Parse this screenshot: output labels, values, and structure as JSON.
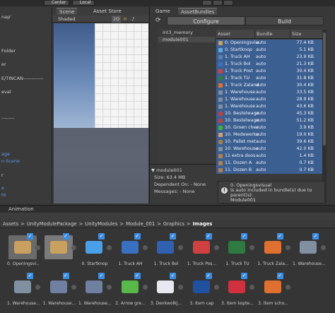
{
  "toolbar": {
    "center_label": "Center",
    "local_label": "Local"
  },
  "tabs": {
    "scene": "Scene",
    "asset_store": "Asset Store",
    "game": "Game",
    "asset_bundles": "AssetBundles"
  },
  "hierarchy": {
    "rows": [
      {
        "text": "nap'",
        "style": "normal"
      },
      {
        "text": "Folder",
        "style": "normal"
      },
      {
        "text": "er",
        "style": "normal"
      },
      {
        "text": "E/TINCAN------------",
        "style": "normal"
      },
      {
        "text": "eval",
        "style": "normal"
      },
      {
        "text": "--------",
        "style": "normal"
      },
      {
        "text": "age",
        "style": "blue"
      },
      {
        "text": "n Scene",
        "style": "blue"
      },
      {
        "text": "r",
        "style": "normal"
      },
      {
        "text": "e",
        "style": "blue"
      },
      {
        "text": "ht",
        "style": "blue"
      }
    ]
  },
  "scene_toolbar": {
    "shading_mode": "Shaded",
    "mode_2d": "2D"
  },
  "asset_bundles": {
    "configure_label": "Configure",
    "build_label": "Build",
    "refresh_icon": "refresh-icon",
    "bundles": [
      "int3_memory",
      "module001"
    ],
    "columns": [
      "Asset",
      "Bundle",
      "Size"
    ],
    "rows": [
      {
        "asset": "0. Openingsvisual",
        "bundle": "auto",
        "size": "77.4 KB",
        "color": "#c8a060"
      },
      {
        "asset": "0. Startknop",
        "bundle": "auto",
        "size": "5.1 KB",
        "color": "#60a8e0"
      },
      {
        "asset": "1. Truck AH",
        "bundle": "auto",
        "size": "23.9 KB",
        "color": "#5a80b0"
      },
      {
        "asset": "1. Truck Bol",
        "bundle": "auto",
        "size": "21.3 KB",
        "color": "#4070c0"
      },
      {
        "asset": "1. Truck Post",
        "bundle": "auto",
        "size": "30.4 KB",
        "color": "#d04040"
      },
      {
        "asset": "1. Truck TU",
        "bundle": "auto",
        "size": "31.8 KB",
        "color": "#308040"
      },
      {
        "asset": "1. Truck Zalando",
        "bundle": "auto",
        "size": "30.4 KB",
        "color": "#e07030"
      },
      {
        "asset": "1. Warehouse",
        "bundle": "auto",
        "size": "33.5 KB",
        "color": "#8090a0"
      },
      {
        "asset": "1. Warehouse",
        "bundle": "auto",
        "size": "28.9 KB",
        "color": "#8090a0"
      },
      {
        "asset": "1. Warehouse",
        "bundle": "auto",
        "size": "43.6 KB",
        "color": "#8090a0"
      },
      {
        "asset": "10. Bestelwagen",
        "bundle": "auto",
        "size": "45.3 KB",
        "color": "#c04040"
      },
      {
        "asset": "10. Bestelwagen",
        "bundle": "auto",
        "size": "51.2 KB",
        "color": "#c04040"
      },
      {
        "asset": "10. Groen check",
        "bundle": "auto",
        "size": "3.9 KB",
        "color": "#40b040"
      },
      {
        "asset": "10. Medewerker",
        "bundle": "auto",
        "size": "19.0 KB",
        "color": "#d0a070"
      },
      {
        "asset": "10. Pallet met",
        "bundle": "auto",
        "size": "39.6 KB",
        "color": "#a08050"
      },
      {
        "asset": "10. Warehouse",
        "bundle": "auto",
        "size": "42.0 KB",
        "color": "#8090a0"
      },
      {
        "asset": "11 extra doos",
        "bundle": "auto",
        "size": "1.4 KB",
        "color": "#b08050"
      },
      {
        "asset": "11. Dozen A",
        "bundle": "auto",
        "size": "0.7 KB",
        "color": "#b08050"
      },
      {
        "asset": "11. Dozen B",
        "bundle": "auto",
        "size": "0.7 KB",
        "color": "#b08050"
      }
    ]
  },
  "bundle_info": {
    "name": "module001",
    "size": "Size: 63.4 MB",
    "dependent_on": "Dependent On: - None",
    "messages": "Messages: - None"
  },
  "message": {
    "icon": "info-icon",
    "lines": [
      "0. Openingsvisual",
      "Is auto included in bundle(s) due to",
      "parent(s):",
      "Module001"
    ]
  },
  "animation_tab": "Animation",
  "breadcrumb": {
    "parts": [
      "Assets",
      "UnityModulePackage",
      "UnityModules",
      "Module_001",
      "Graphics"
    ],
    "current": "Images",
    "separator": ">"
  },
  "project_tiles": [
    {
      "label": "0. Openingsvi...",
      "color": "#c8a060",
      "bg": "#6a6a6a"
    },
    {
      "label": "",
      "color": "#c8a060",
      "bg": "#7a7a7a"
    },
    {
      "label": "0. Startknop",
      "color": "#4aa0e8",
      "bg": "#353535"
    },
    {
      "label": "1. Truck AH",
      "color": "#3a70c0",
      "bg": "#353535"
    },
    {
      "label": "1. Truck Bol",
      "color": "#3060b0",
      "bg": "#353535"
    },
    {
      "label": "1. Truck Pos...",
      "color": "#d04040",
      "bg": "#353535"
    },
    {
      "label": "1. Truck TU",
      "color": "#2e7a40",
      "bg": "#353535"
    },
    {
      "label": "1. Truck Zala...",
      "color": "#e07030",
      "bg": "#353535"
    },
    {
      "label": "1. Warehouse...",
      "color": "#8090a0",
      "bg": "#353535"
    },
    {
      "label": "1. Warehouse...",
      "color": "#8090a0",
      "bg": "#353535"
    },
    {
      "label": "1. Warehouse...",
      "color": "#7080a0",
      "bg": "#353535"
    },
    {
      "label": "1. Warehouse...",
      "color": "#7080a0",
      "bg": "#353535"
    },
    {
      "label": "2. Arrow gre...",
      "color": "#58b848",
      "bg": "#353535"
    },
    {
      "label": "3. Denkwolkj...",
      "color": "#e8e8f0",
      "bg": "#353535"
    },
    {
      "label": "3. Item cap",
      "color": "#2050a0",
      "bg": "#353535"
    },
    {
      "label": "3. Item kopte...",
      "color": "#d03040",
      "bg": "#353535"
    },
    {
      "label": "3. Item scho...",
      "color": "#e07030",
      "bg": "#353535"
    }
  ],
  "accent_blue": "#3d8ee0",
  "selection_blue": "#3c5f91"
}
